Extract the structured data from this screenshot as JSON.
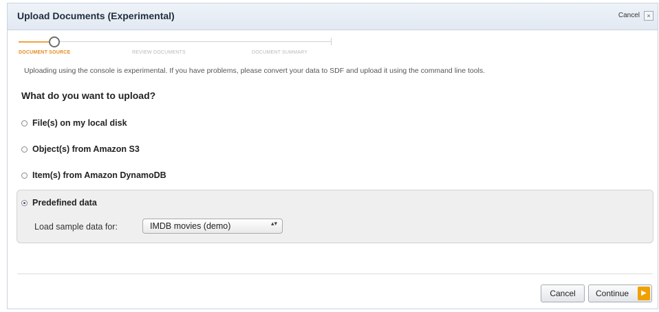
{
  "dialog": {
    "title": "Upload Documents (Experimental)",
    "cancel_link": "Cancel",
    "close_glyph": "×"
  },
  "wizard": {
    "steps": [
      "DOCUMENT SOURCE",
      "REVIEW DOCUMENTS",
      "DOCUMENT SUMMARY"
    ],
    "active_step": 0,
    "active_color": "#e58a1f"
  },
  "note": "Uploading using the console is experimental. If you have problems, please convert your data to SDF and upload it using the command line tools.",
  "question": "What do you want to upload?",
  "options": [
    {
      "label": "File(s) on my local disk",
      "selected": false
    },
    {
      "label": "Object(s) from Amazon S3",
      "selected": false
    },
    {
      "label": "Item(s) from Amazon DynamoDB",
      "selected": false
    },
    {
      "label": "Predefined data",
      "selected": true
    }
  ],
  "predefined": {
    "load_label": "Load sample data for:",
    "selected_value": "IMDB movies (demo)",
    "arrow_glyph": "▴▾"
  },
  "buttons": {
    "cancel": "Cancel",
    "continue": "Continue",
    "continue_icon": "▶",
    "continue_icon_name": "play-arrow-icon"
  }
}
